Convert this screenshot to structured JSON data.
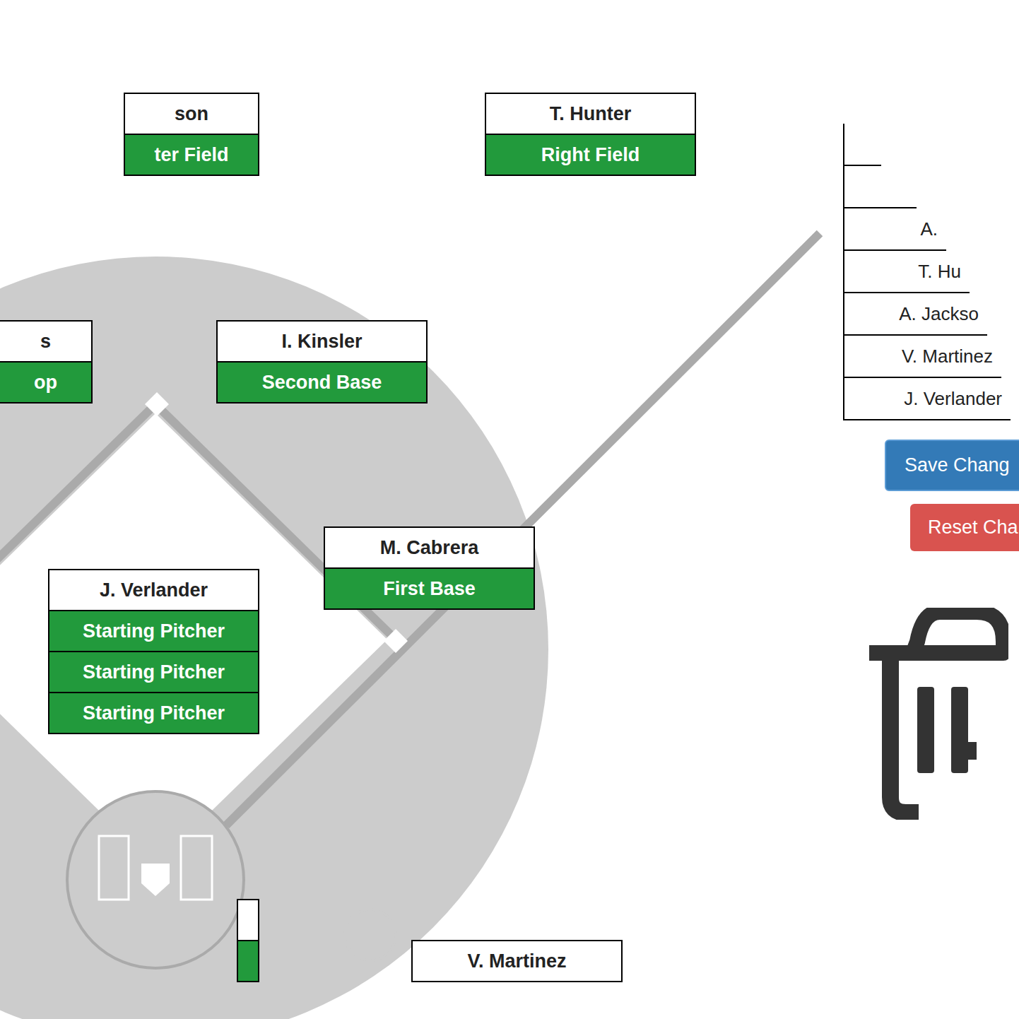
{
  "field_cards": [
    {
      "name": "son",
      "positions": [
        "ter Field"
      ]
    },
    {
      "name": "T. Hunter",
      "positions": [
        "Right Field"
      ]
    },
    {
      "name": "s",
      "positions": [
        "op"
      ]
    },
    {
      "name": "I. Kinsler",
      "positions": [
        "Second Base"
      ]
    },
    {
      "name": "M. Cabrera",
      "positions": [
        "First Base"
      ]
    },
    {
      "name": "J. Verlander",
      "positions": [
        "Starting Pitcher",
        "Starting Pitcher",
        "Starting Pitcher"
      ]
    },
    {
      "name": "",
      "positions": [
        ""
      ]
    },
    {
      "name": "V. Martinez",
      "positions": []
    }
  ],
  "roster": [
    "",
    "",
    "A.",
    "T. Hu",
    "A. Jackso",
    "V. Martinez",
    "J. Verlander"
  ],
  "buttons": {
    "save": "Save Chang",
    "reset": "Reset Cha"
  }
}
